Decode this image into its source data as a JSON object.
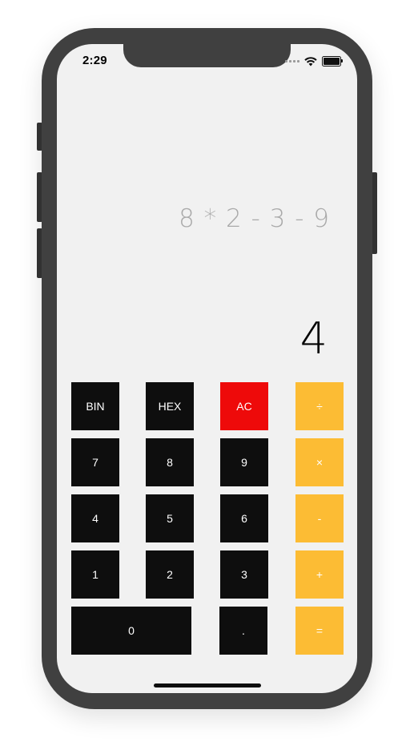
{
  "status_bar": {
    "time": "2:29"
  },
  "display": {
    "expression": "8 * 2 - 3 - 9",
    "result": "4"
  },
  "keys": {
    "bin": "BIN",
    "hex": "HEX",
    "clear": "AC",
    "divide": "÷",
    "seven": "7",
    "eight": "8",
    "nine": "9",
    "multiply": "×",
    "four": "4",
    "five": "5",
    "six": "6",
    "subtract": "-",
    "one": "1",
    "two": "2",
    "three": "3",
    "add": "+",
    "zero": "0",
    "decimal": ".",
    "equals": "="
  },
  "colors": {
    "number_key": "#0e0e0e",
    "clear_key": "#ee0a0a",
    "operator_key": "#fcbc34",
    "screen_background": "#f1f1f1",
    "expression_text": "#a9a9a9",
    "result_text": "#000000"
  },
  "icons": {
    "signal": "signal-dots-icon",
    "wifi": "wifi-icon",
    "battery": "battery-icon"
  }
}
